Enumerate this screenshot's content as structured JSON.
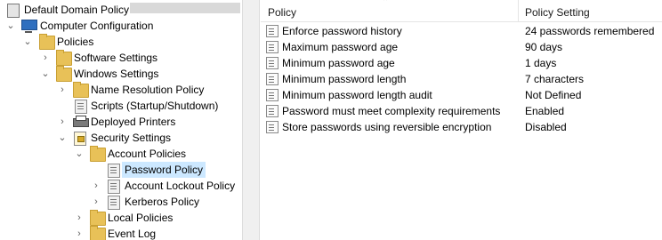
{
  "tree": {
    "root": "Default Domain Policy",
    "items": [
      {
        "label": "Computer Configuration",
        "expanded": "open",
        "icon": "computer-icon"
      },
      {
        "label": "Policies",
        "expanded": "open",
        "icon": "folder-icon"
      },
      {
        "label": "Software Settings",
        "expanded": "closed",
        "icon": "folder-icon"
      },
      {
        "label": "Windows Settings",
        "expanded": "open",
        "icon": "folder-icon"
      },
      {
        "label": "Name Resolution Policy",
        "expanded": "closed",
        "icon": "folder-icon"
      },
      {
        "label": "Scripts (Startup/Shutdown)",
        "expanded": "none",
        "icon": "script-icon"
      },
      {
        "label": "Deployed Printers",
        "expanded": "closed",
        "icon": "printer-icon"
      },
      {
        "label": "Security Settings",
        "expanded": "open",
        "icon": "security-icon"
      },
      {
        "label": "Account Policies",
        "expanded": "open",
        "icon": "folder-icon"
      },
      {
        "label": "Password Policy",
        "expanded": "none",
        "icon": "policy-icon",
        "selected": true
      },
      {
        "label": "Account Lockout Policy",
        "expanded": "closed",
        "icon": "policy-icon"
      },
      {
        "label": "Kerberos Policy",
        "expanded": "closed",
        "icon": "policy-icon"
      },
      {
        "label": "Local Policies",
        "expanded": "closed",
        "icon": "folder-icon"
      },
      {
        "label": "Event Log",
        "expanded": "closed",
        "icon": "folder-icon"
      }
    ]
  },
  "list": {
    "columns": [
      "Policy",
      "Policy Setting"
    ],
    "rows": [
      {
        "policy": "Enforce password history",
        "setting": "24 passwords remembered"
      },
      {
        "policy": "Maximum password age",
        "setting": "90 days"
      },
      {
        "policy": "Minimum password age",
        "setting": "1 days"
      },
      {
        "policy": "Minimum password length",
        "setting": "7 characters"
      },
      {
        "policy": "Minimum password length audit",
        "setting": "Not Defined"
      },
      {
        "policy": "Password must meet complexity requirements",
        "setting": "Enabled"
      },
      {
        "policy": "Store passwords using reversible encryption",
        "setting": "Disabled"
      }
    ]
  },
  "colors": {
    "selection": "#cce8ff",
    "splitter": "#f0f0f0"
  }
}
